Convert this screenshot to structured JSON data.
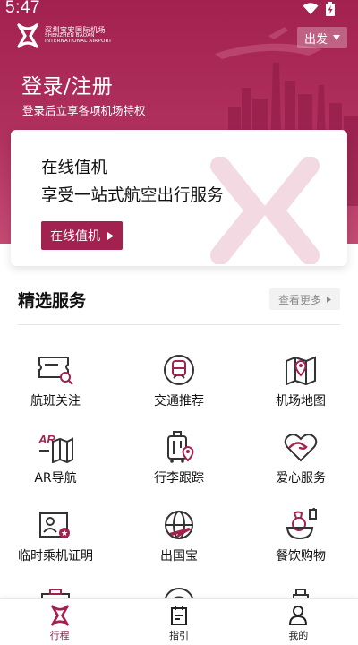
{
  "status_bar": {
    "time": "5:47"
  },
  "header": {
    "logo_cn": "深圳宝安国际机场",
    "logo_en_1": "SHENZHEN BAOAN",
    "logo_en_2": "INTERNATIONAL AIRPORT",
    "departure_select": "出发",
    "title": "登录/注册",
    "subtitle": "登录后立享各项机场特权"
  },
  "checkin_card": {
    "line1": "在线值机",
    "line2": "享受一站式航空出行服务",
    "button_label": "在线值机"
  },
  "services": {
    "title": "精选服务",
    "more_label": "查看更多",
    "items": [
      {
        "label": "航班关注",
        "icon": "flight-ticket-search-icon"
      },
      {
        "label": "交通推荐",
        "icon": "train-icon"
      },
      {
        "label": "机场地图",
        "icon": "map-pin-icon"
      },
      {
        "label": "AR导航",
        "icon": "ar-map-icon"
      },
      {
        "label": "行李跟踪",
        "icon": "luggage-location-icon"
      },
      {
        "label": "爱心服务",
        "icon": "heart-hand-icon"
      },
      {
        "label": "临时乘机证明",
        "icon": "id-card-icon"
      },
      {
        "label": "出国宝",
        "icon": "globe-plane-icon"
      },
      {
        "label": "餐饮购物",
        "icon": "food-drink-icon"
      }
    ]
  },
  "bottom_nav": {
    "items": [
      {
        "label": "行程",
        "active": true
      },
      {
        "label": "指引",
        "active": false
      },
      {
        "label": "我的",
        "active": false
      }
    ]
  },
  "colors": {
    "brand": "#a3214f",
    "brand_light": "#c24a73",
    "icon_gray": "#333333"
  }
}
